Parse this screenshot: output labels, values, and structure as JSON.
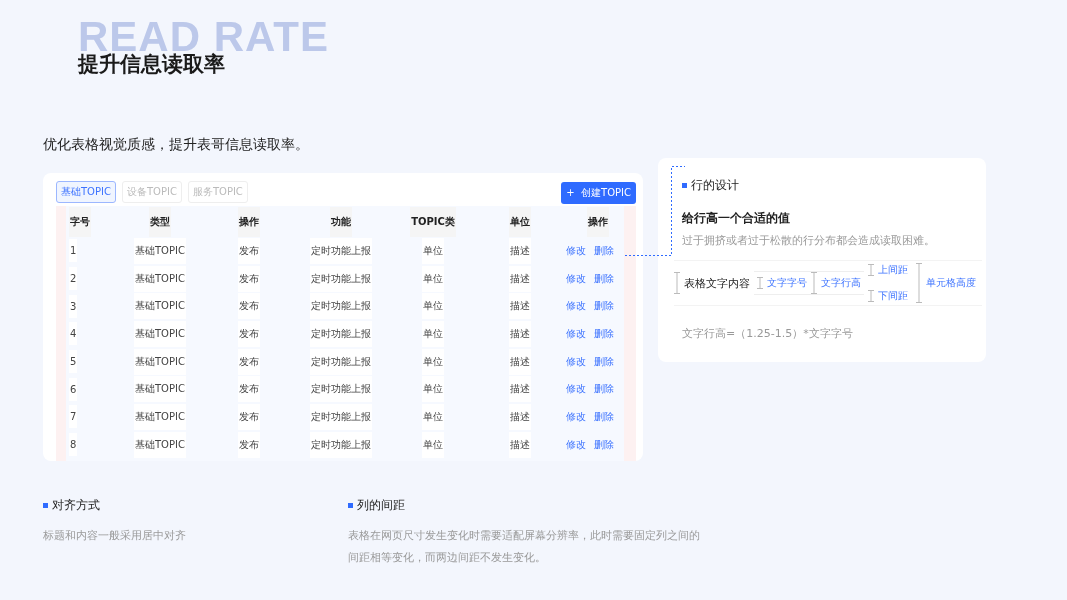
{
  "watermark": "READ RATE",
  "title": "提升信息读取率",
  "subtitle": "优化表格视觉质感，提升表哥信息读取率。",
  "table_panel": {
    "tabs": [
      {
        "label": "基础TOPIC",
        "selected": true
      },
      {
        "label": "设备TOPIC",
        "selected": false
      },
      {
        "label": "服务TOPIC",
        "selected": false
      }
    ],
    "create_button": {
      "icon": "+",
      "label": "创建TOPIC"
    },
    "columns": [
      "字号",
      "类型",
      "操作",
      "功能",
      "TOPIC类",
      "单位",
      "操作"
    ],
    "rows": [
      {
        "cells": [
          "1",
          "基础TOPIC",
          "发布",
          "定时功能上报",
          "单位",
          "描述"
        ],
        "actions": [
          "修改",
          "删除"
        ]
      },
      {
        "cells": [
          "2",
          "基础TOPIC",
          "发布",
          "定时功能上报",
          "单位",
          "描述"
        ],
        "actions": [
          "修改",
          "删除"
        ]
      },
      {
        "cells": [
          "3",
          "基础TOPIC",
          "发布",
          "定时功能上报",
          "单位",
          "描述"
        ],
        "actions": [
          "修改",
          "删除"
        ]
      },
      {
        "cells": [
          "4",
          "基础TOPIC",
          "发布",
          "定时功能上报",
          "单位",
          "描述"
        ],
        "actions": [
          "修改",
          "删除"
        ]
      },
      {
        "cells": [
          "5",
          "基础TOPIC",
          "发布",
          "定时功能上报",
          "单位",
          "描述"
        ],
        "actions": [
          "修改",
          "删除"
        ]
      },
      {
        "cells": [
          "6",
          "基础TOPIC",
          "发布",
          "定时功能上报",
          "单位",
          "描述"
        ],
        "actions": [
          "修改",
          "删除"
        ]
      },
      {
        "cells": [
          "7",
          "基础TOPIC",
          "发布",
          "定时功能上报",
          "单位",
          "描述"
        ],
        "actions": [
          "修改",
          "删除"
        ]
      },
      {
        "cells": [
          "8",
          "基础TOPIC",
          "发布",
          "定时功能上报",
          "单位",
          "描述"
        ],
        "actions": [
          "修改",
          "删除"
        ]
      }
    ]
  },
  "row_design": {
    "heading": "行的设计",
    "subheading": "给行高一个合适的值",
    "description": "过于拥挤或者过于松散的行分布都会造成读取困难。",
    "diagram": {
      "sample_text": "表格文字内容",
      "font_size_label": "文字字号",
      "line_height_label": "文字行高",
      "top_padding_label": "上间距",
      "bottom_padding_label": "下间距",
      "cell_height_label": "单元格高度"
    },
    "formula": "文字行高=（1.25-1.5）*文字字号"
  },
  "sections": [
    {
      "heading": "对齐方式",
      "text": "标题和内容一般采用居中对齐"
    },
    {
      "heading": "列的间距",
      "text": "表格在网页尺寸发生变化时需要适配屏幕分辨率，此时需要固定列之间的间距相等变化，而两边间距不发生变化。"
    }
  ]
}
